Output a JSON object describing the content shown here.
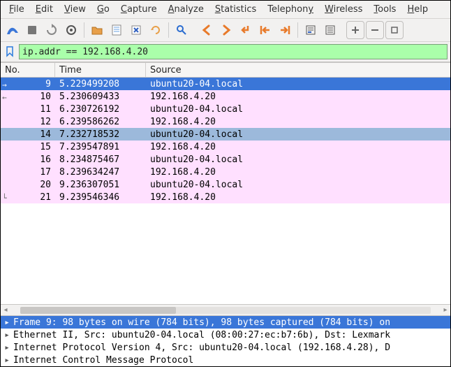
{
  "menu": {
    "file": "File",
    "edit": "Edit",
    "view": "View",
    "go": "Go",
    "capture": "Capture",
    "analyze": "Analyze",
    "statistics": "Statistics",
    "telephony": "Telephony",
    "wireless": "Wireless",
    "tools": "Tools",
    "help": "Help"
  },
  "filter": {
    "value": "ip.addr == 192.168.4.20"
  },
  "columns": {
    "no": "No.",
    "time": "Time",
    "source": "Source"
  },
  "packets": [
    {
      "no": "9",
      "time": "5.229499208",
      "source": "ubuntu20-04.local",
      "state": "sel-primary",
      "marker": "right"
    },
    {
      "no": "10",
      "time": "5.230609433",
      "source": "192.168.4.20",
      "state": "pink",
      "marker": "left"
    },
    {
      "no": "11",
      "time": "6.230726192",
      "source": "ubuntu20-04.local",
      "state": "pink"
    },
    {
      "no": "12",
      "time": "6.239586262",
      "source": "192.168.4.20",
      "state": "pink"
    },
    {
      "no": "14",
      "time": "7.232718532",
      "source": "ubuntu20-04.local",
      "state": "sel-secondary"
    },
    {
      "no": "15",
      "time": "7.239547891",
      "source": "192.168.4.20",
      "state": "pink"
    },
    {
      "no": "16",
      "time": "8.234875467",
      "source": "ubuntu20-04.local",
      "state": "pink"
    },
    {
      "no": "17",
      "time": "8.239634247",
      "source": "192.168.4.20",
      "state": "pink"
    },
    {
      "no": "20",
      "time": "9.236307051",
      "source": "ubuntu20-04.local",
      "state": "pink"
    },
    {
      "no": "21",
      "time": "9.239546346",
      "source": "192.168.4.20",
      "state": "pink",
      "marker": "end"
    }
  ],
  "details": [
    {
      "text": "Frame 9: 98 bytes on wire (784 bits), 98 bytes captured (784 bits) on",
      "sel": true
    },
    {
      "text": "Ethernet II, Src: ubuntu20-04.local (08:00:27:ec:b7:6b), Dst: Lexmark",
      "sel": false
    },
    {
      "text": "Internet Protocol Version 4, Src: ubuntu20-04.local (192.168.4.28), D",
      "sel": false
    },
    {
      "text": "Internet Control Message Protocol",
      "sel": false
    }
  ]
}
